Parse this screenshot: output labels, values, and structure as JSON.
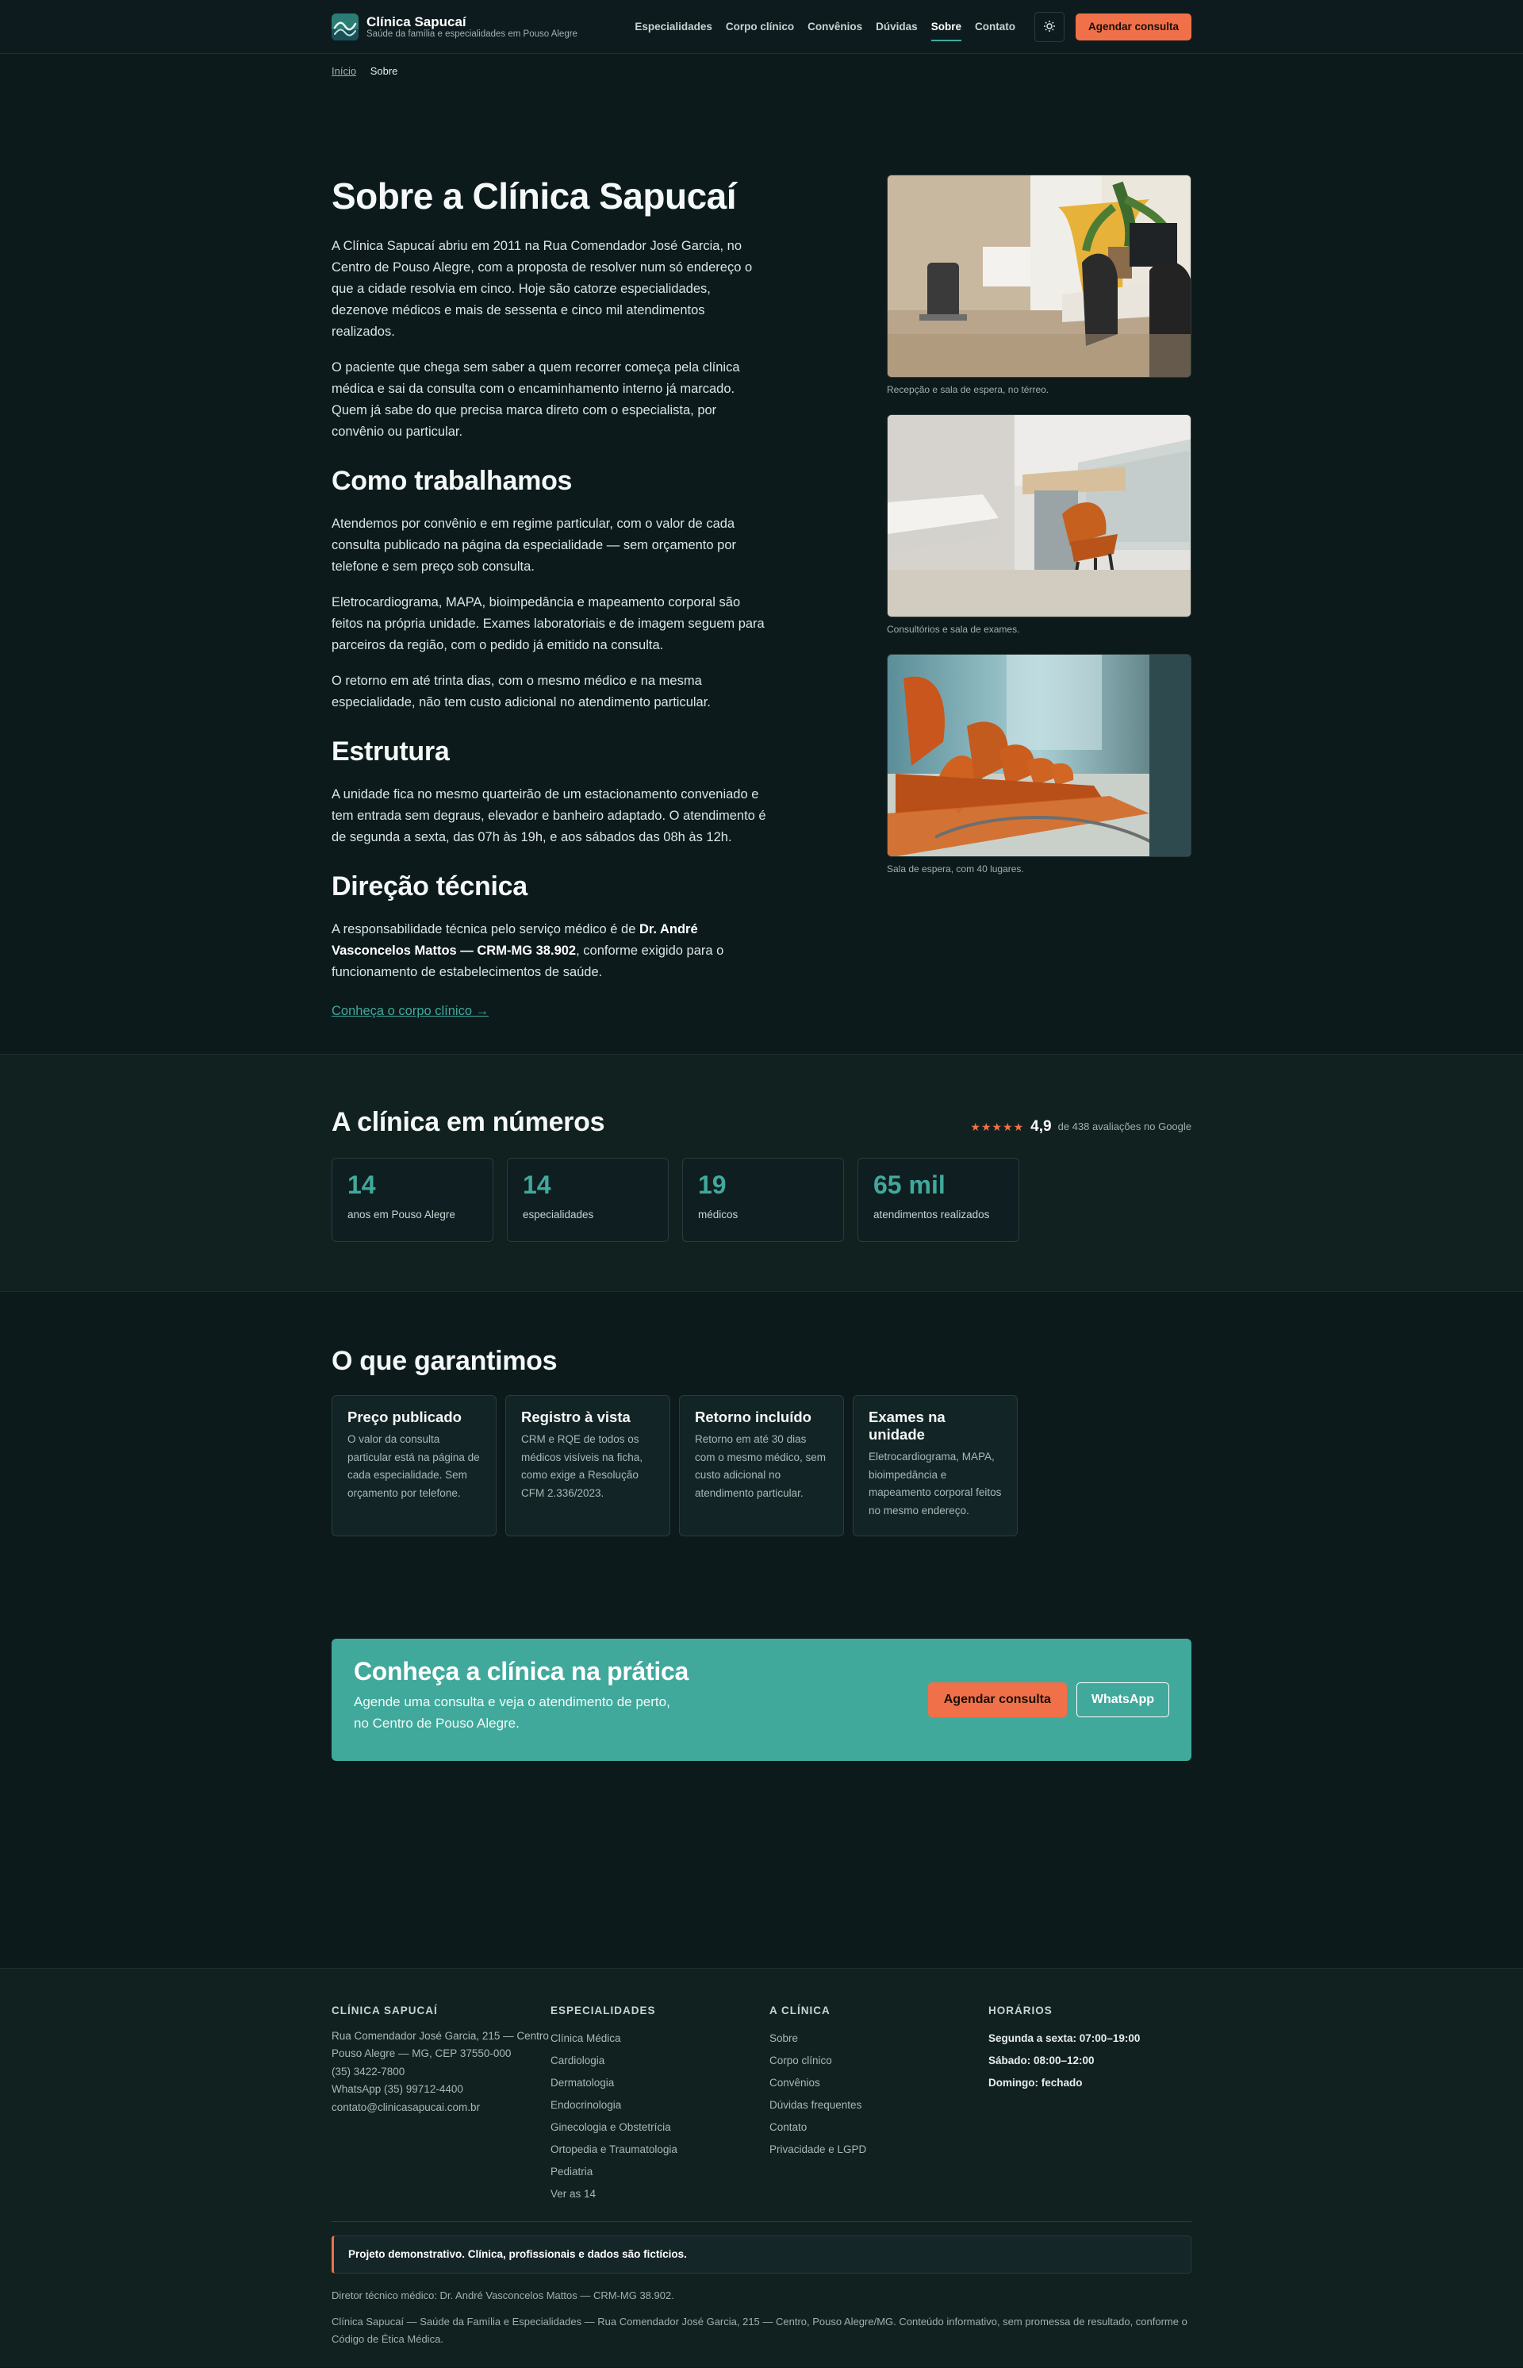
{
  "header": {
    "brand_name": "Clínica Sapucaí",
    "brand_tagline": "Saúde da família e especialidades em Pouso Alegre",
    "nav": [
      "Especialidades",
      "Corpo clínico",
      "Convênios",
      "Dúvidas",
      "Sobre",
      "Contato"
    ],
    "active_nav": "Sobre",
    "theme_icon": "sun-icon",
    "cta_label": "Agendar consulta"
  },
  "breadcrumb": {
    "home": "Início",
    "current": "Sobre"
  },
  "about": {
    "title": "Sobre a Clínica Sapucaí",
    "intro": [
      "A Clínica Sapucaí abriu em 2011 na Rua Comendador José Garcia, no Centro de Pouso Alegre, com a proposta de resolver num só endereço o que a cidade resolvia em cinco. Hoje são catorze especialidades, dezenove médicos e mais de sessenta e cinco mil atendimentos realizados.",
      "O paciente que chega sem saber a quem recorrer começa pela clínica médica e sai da consulta com o encaminhamento interno já marcado. Quem já sabe do que precisa marca direto com o especialista, por convênio ou particular."
    ],
    "how_title": "Como trabalhamos",
    "how": [
      "Atendemos por convênio e em regime particular, com o valor de cada consulta publicado na página da especialidade — sem orçamento por telefone e sem preço sob consulta.",
      "Eletrocardiograma, MAPA, bioimpedância e mapeamento corporal são feitos na própria unidade. Exames laboratoriais e de imagem seguem para parceiros da região, com o pedido já emitido na consulta.",
      "O retorno em até trinta dias, com o mesmo médico e na mesma especialidade, não tem custo adicional no atendimento particular."
    ],
    "structure_title": "Estrutura",
    "structure": "A unidade fica no mesmo quarteirão de um estacionamento conveniado e tem entrada sem degraus, elevador e banheiro adaptado. O atendimento é de segunda a sexta, das 07h às 19h, e aos sábados das 08h às 12h.",
    "direction_title": "Direção técnica",
    "direction_before": "A responsabilidade técnica pelo serviço médico é de ",
    "direction_name": "Dr. André Vasconcelos Mattos — CRM-MG 38.902",
    "direction_after": ", conforme exigido para o funcionamento de estabelecimentos de saúde.",
    "link": "Conheça o corpo clínico →",
    "photos": [
      {
        "caption": "Recepção e sala de espera, no térreo."
      },
      {
        "caption": "Consultórios e sala de exames."
      },
      {
        "caption": "Sala de espera, com 40 lugares."
      }
    ]
  },
  "numbers": {
    "title": "A clínica em números",
    "stars": "★★★★★",
    "rating": "4,9",
    "reviews": "de 438 avaliações no Google",
    "stats": [
      {
        "value": "14",
        "label": "anos em Pouso Alegre"
      },
      {
        "value": "14",
        "label": "especialidades"
      },
      {
        "value": "19",
        "label": "médicos"
      },
      {
        "value": "65 mil",
        "label": "atendimentos realizados"
      }
    ]
  },
  "guarantees": {
    "title": "O que garantimos",
    "items": [
      {
        "title": "Preço publicado",
        "text": "O valor da consulta particular está na página de cada especialidade. Sem orçamento por telefone."
      },
      {
        "title": "Registro à vista",
        "text": "CRM e RQE de todos os médicos visíveis na ficha, como exige a Resolução CFM 2.336/2023."
      },
      {
        "title": "Retorno incluído",
        "text": "Retorno em até 30 dias com o mesmo médico, sem custo adicional no atendimento particular."
      },
      {
        "title": "Exames na unidade",
        "text": "Eletrocardiograma, MAPA, bioimpedância e mapeamento corporal feitos no mesmo endereço."
      }
    ]
  },
  "cta": {
    "title": "Conheça a clínica na prática",
    "subtitle": "Agende uma consulta e veja o atendimento de perto, no Centro de Pouso Alegre.",
    "primary": "Agendar consulta",
    "secondary": "WhatsApp"
  },
  "footer": {
    "col1": {
      "head": "CLÍNICA SAPUCAÍ",
      "lines": [
        "Rua Comendador José Garcia, 215 — Centro",
        "Pouso Alegre — MG, CEP 37550-000",
        "(35) 3422-7800",
        "WhatsApp (35) 99712-4400",
        "contato@clinicasapucai.com.br"
      ]
    },
    "col2": {
      "head": "ESPECIALIDADES",
      "links": [
        "Clínica Médica",
        "Cardiologia",
        "Dermatologia",
        "Endocrinologia",
        "Ginecologia e Obstetrícia",
        "Ortopedia e Traumatologia",
        "Pediatria",
        "Ver as 14"
      ]
    },
    "col3": {
      "head": "A CLÍNICA",
      "links": [
        "Sobre",
        "Corpo clínico",
        "Convênios",
        "Dúvidas frequentes",
        "Contato",
        "Privacidade e LGPD"
      ]
    },
    "col4": {
      "head": "HORÁRIOS",
      "lines": [
        "Segunda a sexta: 07:00–19:00",
        "Sábado: 08:00–12:00",
        "Domingo: fechado"
      ]
    },
    "disclaimer": "Projeto demonstrativo. Clínica, profissionais e dados são fictícios.",
    "director": "Diretor técnico médico: Dr. André Vasconcelos Mattos — CRM-MG 38.902.",
    "legal": "Clínica Sapucaí — Saúde da Família e Especialidades — Rua Comendador José Garcia, 215 — Centro, Pouso Alegre/MG. Conteúdo informativo, sem promessa de resultado, conforme o Código de Ética Médica."
  }
}
